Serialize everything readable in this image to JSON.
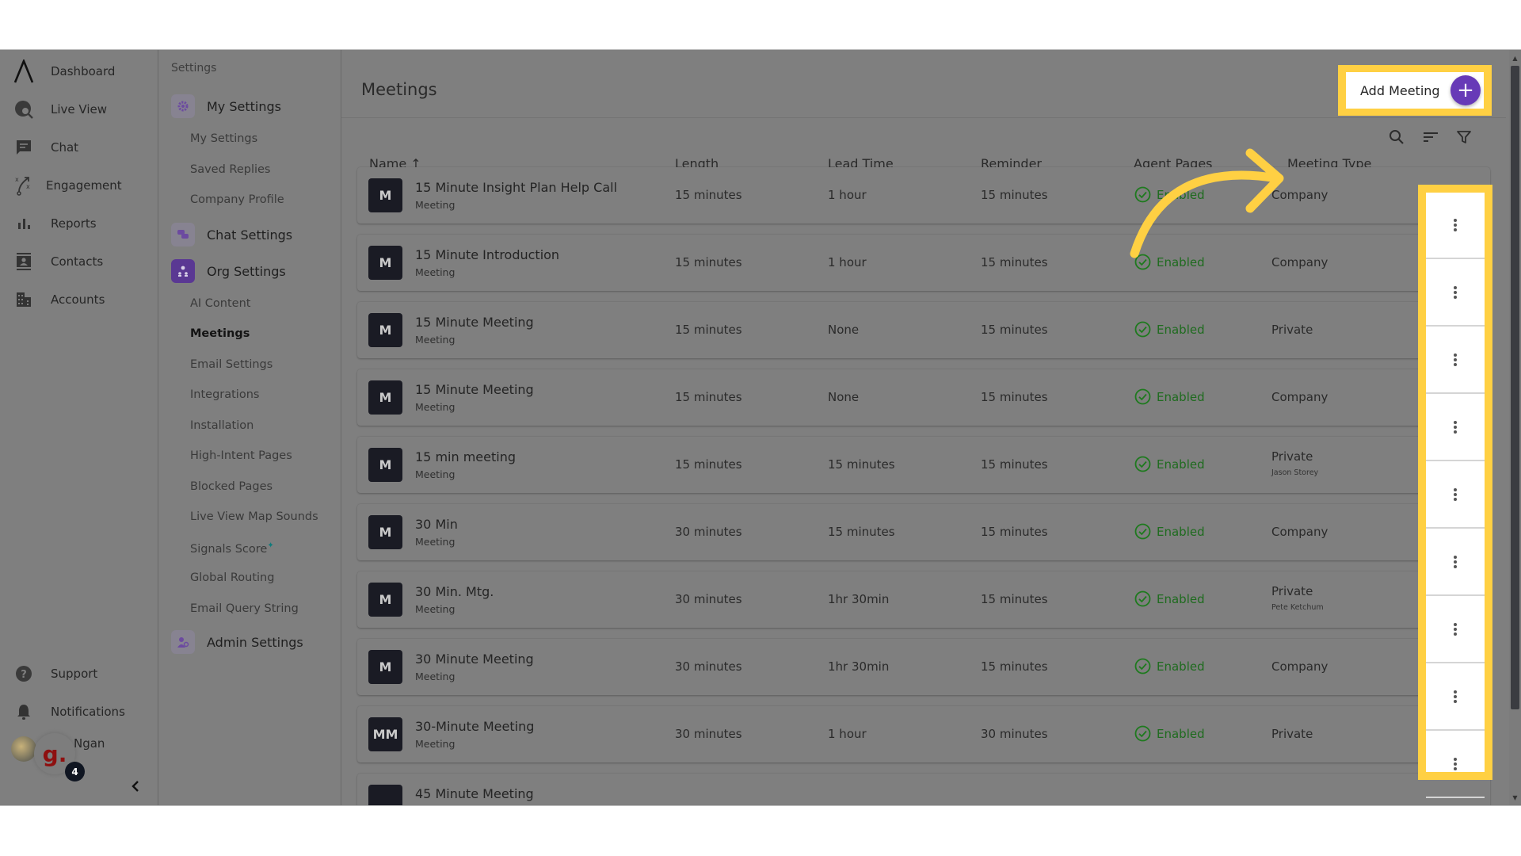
{
  "nav": {
    "items": [
      {
        "label": "Dashboard",
        "icon": "logo-icon"
      },
      {
        "label": "Live View",
        "icon": "live-view-icon"
      },
      {
        "label": "Chat",
        "icon": "chat-icon"
      },
      {
        "label": "Engagement",
        "icon": "engagement-icon"
      },
      {
        "label": "Reports",
        "icon": "reports-icon"
      },
      {
        "label": "Contacts",
        "icon": "contacts-icon"
      },
      {
        "label": "Accounts",
        "icon": "accounts-icon"
      }
    ],
    "bottom": [
      {
        "label": "Support",
        "icon": "help-icon"
      },
      {
        "label": "Notifications",
        "icon": "bell-icon"
      }
    ],
    "user": {
      "name": "Ngan",
      "badge_count": "4",
      "logo_letter": "g."
    }
  },
  "settings": {
    "title": "Settings",
    "groups": [
      {
        "label": "My Settings",
        "items": [
          "My Settings",
          "Saved Replies",
          "Company Profile"
        ]
      },
      {
        "label": "Chat Settings",
        "items": []
      },
      {
        "label": "Org Settings",
        "items": [
          "AI Content",
          "Meetings",
          "Email Settings",
          "Integrations",
          "Installation",
          "High-Intent Pages",
          "Blocked Pages",
          "Live View Map Sounds",
          "Signals Score",
          "Global Routing",
          "Email Query String"
        ]
      },
      {
        "label": "Admin Settings",
        "items": []
      }
    ],
    "active_item": "Meetings"
  },
  "main": {
    "title": "Meetings",
    "add_button": "Add Meeting",
    "columns": [
      "Name",
      "Length",
      "Lead Time",
      "Reminder",
      "Agent Pages",
      "Meeting Type"
    ],
    "sort_indicator": "↑",
    "rows": [
      {
        "avatar": "M",
        "name": "15 Minute Insight Plan Help Call",
        "kind": "Meeting",
        "length": "15 minutes",
        "lead_time": "1 hour",
        "reminder": "15 minutes",
        "agent_pages": "Enabled",
        "type": "Company",
        "owner": ""
      },
      {
        "avatar": "M",
        "name": "15 Minute Introduction",
        "kind": "Meeting",
        "length": "15 minutes",
        "lead_time": "1 hour",
        "reminder": "15 minutes",
        "agent_pages": "Enabled",
        "type": "Company",
        "owner": ""
      },
      {
        "avatar": "M",
        "name": "15 Minute Meeting",
        "kind": "Meeting",
        "length": "15 minutes",
        "lead_time": "None",
        "reminder": "15 minutes",
        "agent_pages": "Enabled",
        "type": "Private",
        "owner": ""
      },
      {
        "avatar": "M",
        "name": "15 Minute Meeting",
        "kind": "Meeting",
        "length": "15 minutes",
        "lead_time": "None",
        "reminder": "15 minutes",
        "agent_pages": "Enabled",
        "type": "Company",
        "owner": ""
      },
      {
        "avatar": "M",
        "name": "15 min meeting",
        "kind": "Meeting",
        "length": "15 minutes",
        "lead_time": "15 minutes",
        "reminder": "15 minutes",
        "agent_pages": "Enabled",
        "type": "Private",
        "owner": "Jason Storey"
      },
      {
        "avatar": "M",
        "name": "30 Min",
        "kind": "Meeting",
        "length": "30 minutes",
        "lead_time": "15 minutes",
        "reminder": "15 minutes",
        "agent_pages": "Enabled",
        "type": "Company",
        "owner": ""
      },
      {
        "avatar": "M",
        "name": "30 Min. Mtg.",
        "kind": "Meeting",
        "length": "30 minutes",
        "lead_time": "1hr 30min",
        "reminder": "15 minutes",
        "agent_pages": "Enabled",
        "type": "Private",
        "owner": "Pete Ketchum"
      },
      {
        "avatar": "M",
        "name": "30 Minute Meeting",
        "kind": "Meeting",
        "length": "30 minutes",
        "lead_time": "1hr 30min",
        "reminder": "15 minutes",
        "agent_pages": "Enabled",
        "type": "Company",
        "owner": ""
      },
      {
        "avatar": "MM",
        "name": "30-Minute Meeting",
        "kind": "Meeting",
        "length": "30 minutes",
        "lead_time": "1 hour",
        "reminder": "30 minutes",
        "agent_pages": "Enabled",
        "type": "Private",
        "owner": ""
      },
      {
        "avatar": "",
        "name": "45 Minute Meeting",
        "kind": "",
        "length": "",
        "lead_time": "",
        "reminder": "",
        "agent_pages": "",
        "type": "",
        "owner": ""
      }
    ]
  },
  "colors": {
    "accent": "#673ab7",
    "highlight": "#ffd043",
    "enabled": "#1e6b1e",
    "overlay": "#7f7f7f"
  }
}
